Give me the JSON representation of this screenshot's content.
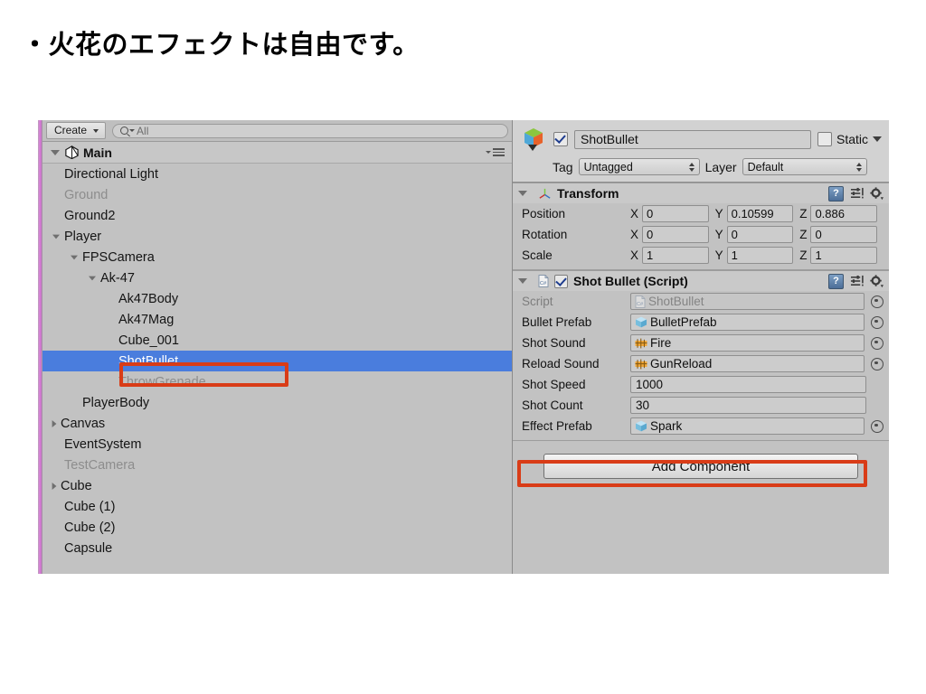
{
  "slide": {
    "title": "・火花のエフェクトは自由です。"
  },
  "colors": {
    "panel_bg": "#c2c2c2",
    "selection_blue": "#4a7ddd",
    "annotation_red": "#d93c17",
    "edge_strip": "#d97fd9"
  },
  "hierarchy": {
    "toolbar": {
      "create_label": "Create",
      "create_icon": "chevron-down-icon",
      "search_icon": "search-icon",
      "search_dropdown_icon": "chevron-down-icon",
      "search_placeholder": "All",
      "search_value": ""
    },
    "scene": {
      "name": "Main",
      "expanded": true,
      "logo_icon": "unity-logo-icon",
      "menu_icon": "hamburger-menu-icon"
    },
    "items": [
      {
        "label": "Directional Light",
        "depth": 1,
        "fold": "none",
        "dim": false,
        "selected": false
      },
      {
        "label": "Ground",
        "depth": 1,
        "fold": "none",
        "dim": true,
        "selected": false
      },
      {
        "label": "Ground2",
        "depth": 1,
        "fold": "none",
        "dim": false,
        "selected": false
      },
      {
        "label": "Player",
        "depth": 1,
        "fold": "open",
        "dim": false,
        "selected": false
      },
      {
        "label": "FPSCamera",
        "depth": 2,
        "fold": "open",
        "dim": false,
        "selected": false
      },
      {
        "label": "Ak-47",
        "depth": 3,
        "fold": "open",
        "dim": false,
        "selected": false
      },
      {
        "label": "Ak47Body",
        "depth": 4,
        "fold": "none",
        "dim": false,
        "selected": false
      },
      {
        "label": "Ak47Mag",
        "depth": 4,
        "fold": "none",
        "dim": false,
        "selected": false
      },
      {
        "label": "Cube_001",
        "depth": 4,
        "fold": "none",
        "dim": false,
        "selected": false
      },
      {
        "label": "ShotBullet",
        "depth": 4,
        "fold": "none",
        "dim": false,
        "selected": true
      },
      {
        "label": "ThrowGrenade",
        "depth": 4,
        "fold": "none",
        "dim": true,
        "selected": false
      },
      {
        "label": "PlayerBody",
        "depth": 2,
        "fold": "none",
        "dim": false,
        "selected": false
      },
      {
        "label": "Canvas",
        "depth": 1,
        "fold": "closed",
        "dim": false,
        "selected": false
      },
      {
        "label": "EventSystem",
        "depth": 1,
        "fold": "none",
        "dim": false,
        "selected": false
      },
      {
        "label": "TestCamera",
        "depth": 1,
        "fold": "none",
        "dim": true,
        "selected": false
      },
      {
        "label": "Cube",
        "depth": 1,
        "fold": "closed",
        "dim": false,
        "selected": false
      },
      {
        "label": "Cube (1)",
        "depth": 1,
        "fold": "none",
        "dim": false,
        "selected": false
      },
      {
        "label": "Cube (2)",
        "depth": 1,
        "fold": "none",
        "dim": false,
        "selected": false
      },
      {
        "label": "Capsule",
        "depth": 1,
        "fold": "none",
        "dim": false,
        "selected": false
      }
    ]
  },
  "inspector": {
    "header": {
      "object_icon": "prefab-cube-icon",
      "enabled": true,
      "name": "ShotBullet",
      "static_label": "Static",
      "static_checked": false,
      "tag_label": "Tag",
      "tag_value": "Untagged",
      "layer_label": "Layer",
      "layer_value": "Default"
    },
    "transform": {
      "title": "Transform",
      "icon": "transform-axis-icon",
      "expanded": true,
      "rows": [
        {
          "label": "Position",
          "x": "0",
          "y": "0.10599",
          "z": "0.886"
        },
        {
          "label": "Rotation",
          "x": "0",
          "y": "0",
          "z": "0"
        },
        {
          "label": "Scale",
          "x": "1",
          "y": "1",
          "z": "1"
        }
      ],
      "axis_labels": [
        "X",
        "Y",
        "Z"
      ]
    },
    "script_component": {
      "title": "Shot Bullet (Script)",
      "icon": "csharp-script-icon",
      "enabled": true,
      "expanded": true,
      "fields": [
        {
          "label": "Script",
          "value": "ShotBullet",
          "kind": "object",
          "icon": "csharp-script-icon",
          "dim": true,
          "highlighted": false
        },
        {
          "label": "Bullet Prefab",
          "value": "BulletPrefab",
          "kind": "object",
          "icon": "prefab-cube-icon",
          "dim": false,
          "highlighted": false
        },
        {
          "label": "Shot Sound",
          "value": "Fire",
          "kind": "object",
          "icon": "audio-clip-icon",
          "dim": false,
          "highlighted": false
        },
        {
          "label": "Reload Sound",
          "value": "GunReload",
          "kind": "object",
          "icon": "audio-clip-icon",
          "dim": false,
          "highlighted": false
        },
        {
          "label": "Shot Speed",
          "value": "1000",
          "kind": "number",
          "icon": "",
          "dim": false,
          "highlighted": false
        },
        {
          "label": "Shot Count",
          "value": "30",
          "kind": "number",
          "icon": "",
          "dim": false,
          "highlighted": false
        },
        {
          "label": "Effect Prefab",
          "value": "Spark",
          "kind": "object",
          "icon": "prefab-cube-icon",
          "dim": false,
          "highlighted": true
        }
      ]
    },
    "add_component_label": "Add Component",
    "icons": {
      "help": "help-book-icon",
      "preset": "preset-sliders-icon",
      "settings": "gear-icon"
    }
  }
}
